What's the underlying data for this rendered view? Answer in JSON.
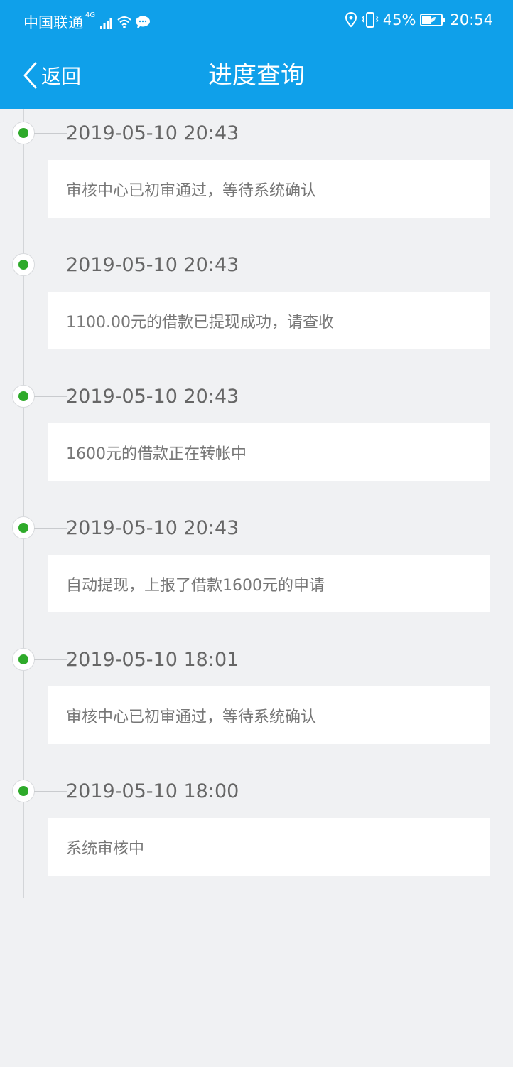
{
  "status_bar": {
    "carrier": "中国联通",
    "network_type": "4G",
    "battery_percent": "45%",
    "time": "20:54",
    "icons": [
      "signal-icon",
      "wifi-icon",
      "message-bubble-icon",
      "location-icon",
      "vibrate-icon",
      "battery-icon"
    ]
  },
  "nav": {
    "back_label": "返回",
    "title": "进度查询"
  },
  "colors": {
    "header_blue": "#0fa0ea",
    "dot_green": "#2eaa2a",
    "background": "#f0f1f3"
  },
  "timeline": [
    {
      "time": "2019-05-10 20:43",
      "message": "审核中心已初审通过，等待系统确认"
    },
    {
      "time": "2019-05-10 20:43",
      "message": "1100.00元的借款已提现成功，请查收"
    },
    {
      "time": "2019-05-10 20:43",
      "message": "1600元的借款正在转帐中"
    },
    {
      "time": "2019-05-10 20:43",
      "message": "自动提现，上报了借款1600元的申请"
    },
    {
      "time": "2019-05-10 18:01",
      "message": "审核中心已初审通过，等待系统确认"
    },
    {
      "time": "2019-05-10 18:00",
      "message": "系统审核中"
    }
  ]
}
